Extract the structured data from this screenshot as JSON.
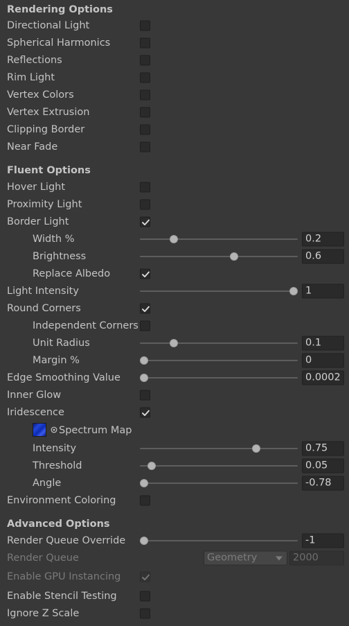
{
  "rendering": {
    "header": "Rendering Options",
    "directional_light": "Directional Light",
    "spherical_harmonics": "Spherical Harmonics",
    "reflections": "Reflections",
    "rim_light": "Rim Light",
    "vertex_colors": "Vertex Colors",
    "vertex_extrusion": "Vertex Extrusion",
    "clipping_border": "Clipping Border",
    "near_fade": "Near Fade",
    "checked": {
      "directional_light": false,
      "spherical_harmonics": false,
      "reflections": false,
      "rim_light": false,
      "vertex_colors": false,
      "vertex_extrusion": false,
      "clipping_border": false,
      "near_fade": false
    }
  },
  "fluent": {
    "header": "Fluent Options",
    "hover_light": "Hover Light",
    "proximity_light": "Proximity Light",
    "border_light": "Border Light",
    "width": {
      "label": "Width %",
      "value": "0.2",
      "fraction": 0.2
    },
    "brightness": {
      "label": "Brightness",
      "value": "0.6",
      "fraction": 0.6
    },
    "replace_albedo": "Replace Albedo",
    "light_intensity": {
      "label": "Light Intensity",
      "value": "1",
      "fraction": 1.0
    },
    "round_corners": "Round Corners",
    "independent_corners": "Independent Corners",
    "unit_radius": {
      "label": "Unit Radius",
      "value": "0.1",
      "fraction": 0.2
    },
    "margin": {
      "label": "Margin %",
      "value": "0",
      "fraction": 0.0
    },
    "edge_smoothing": {
      "label": "Edge Smoothing Value",
      "value": "0.0002",
      "fraction": 0.0
    },
    "inner_glow": "Inner Glow",
    "iridescence": "Iridescence",
    "spectrum_map": "Spectrum Map",
    "intensity": {
      "label": "Intensity",
      "value": "0.75",
      "fraction": 0.75
    },
    "threshold": {
      "label": "Threshold",
      "value": "0.05",
      "fraction": 0.05
    },
    "angle": {
      "label": "Angle",
      "value": "-0.78",
      "fraction": 0.0
    },
    "environment_coloring": "Environment Coloring",
    "checked": {
      "hover_light": false,
      "proximity_light": false,
      "border_light": true,
      "replace_albedo": true,
      "round_corners": true,
      "independent_corners": false,
      "inner_glow": false,
      "iridescence": true,
      "environment_coloring": false
    }
  },
  "advanced": {
    "header": "Advanced Options",
    "render_queue_override": {
      "label": "Render Queue Override",
      "value": "-1",
      "fraction": 0.0
    },
    "render_queue": {
      "label": "Render Queue",
      "dropdown": "Geometry",
      "value": "2000"
    },
    "gpu_instancing": "Enable GPU Instancing",
    "stencil_testing": "Enable Stencil Testing",
    "ignore_z_scale": "Ignore Z Scale",
    "checked": {
      "gpu_instancing": true,
      "stencil_testing": false,
      "ignore_z_scale": false
    }
  },
  "colors": {
    "background": "#383838",
    "text": "#c4c4c4",
    "disabled_text": "#7a7a7a",
    "field": "#2a2a2a"
  },
  "icons": {
    "check": "checkmark-icon",
    "picker": "object-picker-icon",
    "dropdown": "chevron-down-icon"
  }
}
